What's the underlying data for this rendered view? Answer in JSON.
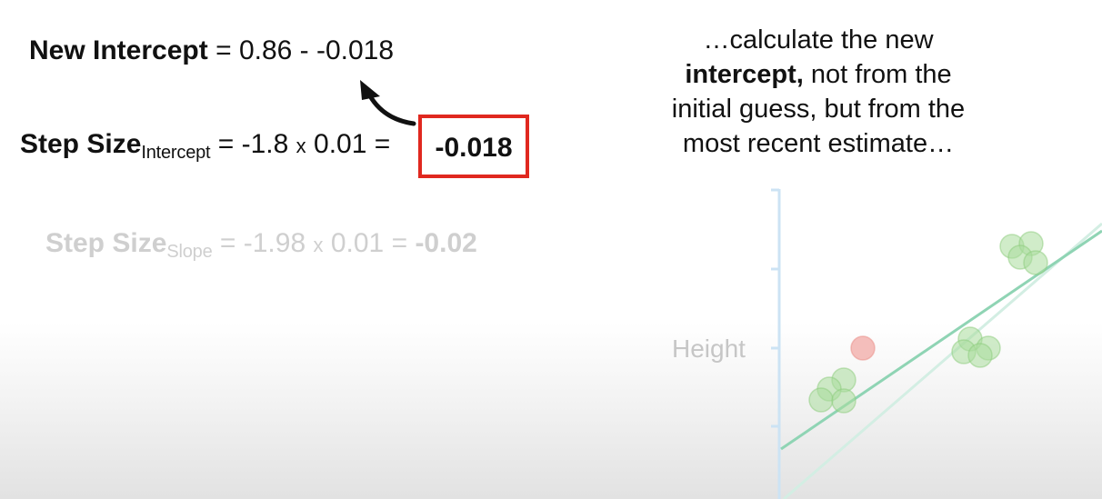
{
  "new_intercept": {
    "label": "New Intercept",
    "equals": "=",
    "expression": "0.86 - -0.018"
  },
  "step_size_intercept": {
    "label": "Step Size",
    "subscript": "Intercept",
    "equals": "=",
    "derivative": "-1.8",
    "times": "x",
    "learning_rate": "0.01",
    "equals2": "=",
    "result": "-0.018"
  },
  "step_size_slope": {
    "label": "Step Size",
    "subscript": "Slope",
    "equals": "=",
    "derivative": "-1.98",
    "times": "x",
    "learning_rate": "0.01",
    "equals2": "=",
    "result": "-0.02"
  },
  "caption": {
    "line1": "…calculate the new",
    "bold_word": "intercept,",
    "line2_rest": " not from the",
    "line3": "initial guess, but from the",
    "line4": "most recent estimate…"
  },
  "plot": {
    "y_axis_label": "Height"
  },
  "colors": {
    "highlight_box": "#e0281f",
    "axis": "#cce3f4",
    "points": "#a9dc9c",
    "outlier_point": "#f2aaa6",
    "fit_line": "#8fd4b4",
    "faded_text": "#cfcfcf"
  }
}
